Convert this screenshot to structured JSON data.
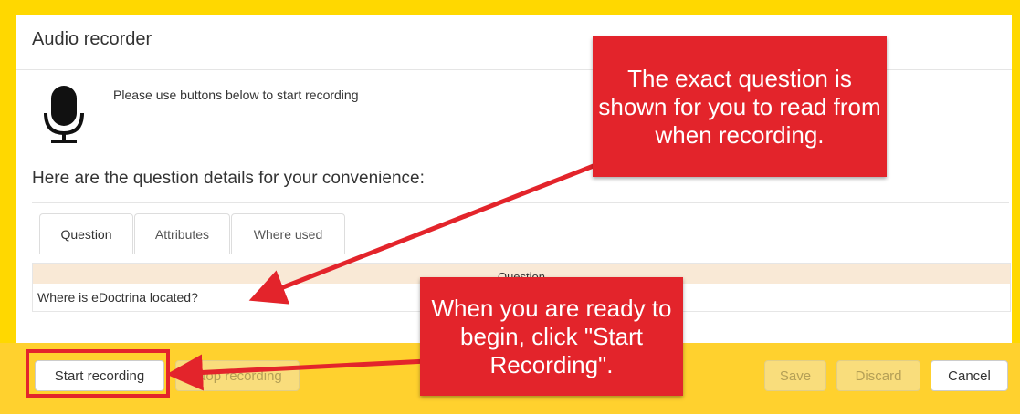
{
  "dialog": {
    "title": "Audio recorder",
    "mic_icon": "microphone-icon",
    "instruction": "Please use buttons below to start recording",
    "details_heading": "Here are the question details for your convenience:"
  },
  "tabs": [
    {
      "label": "Question",
      "active": true
    },
    {
      "label": "Attributes",
      "active": false
    },
    {
      "label": "Where used",
      "active": false
    }
  ],
  "question_table": {
    "header": "Question",
    "rows": [
      "Where is eDoctrina located?"
    ]
  },
  "footer": {
    "start_label": "Start recording",
    "stop_label": "Stop recording",
    "save_label": "Save",
    "discard_label": "Discard",
    "cancel_label": "Cancel"
  },
  "annotations": {
    "callout_question": "The exact question is shown for you to read from when recording.",
    "callout_start": "When you are ready to begin, click \"Start Recording\"."
  },
  "colors": {
    "frame": "#ffd800",
    "footer": "#ffd12e",
    "callout": "#e3242b",
    "table_header": "#f9e9d6"
  }
}
